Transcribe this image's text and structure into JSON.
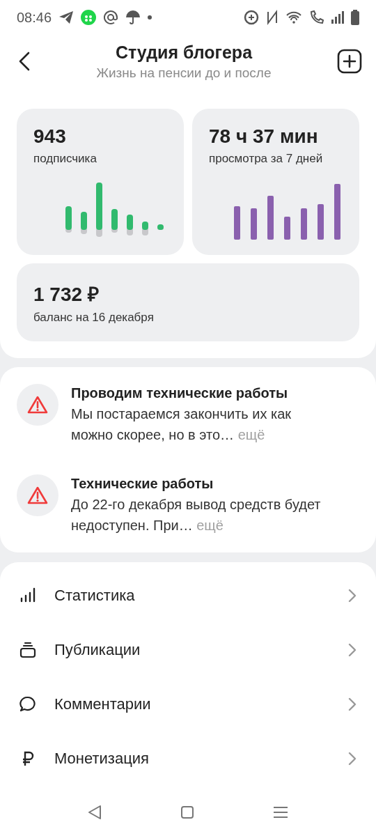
{
  "status_bar": {
    "time": "08:46"
  },
  "header": {
    "title": "Студия блогера",
    "subtitle": "Жизнь на пенсии до и после"
  },
  "stats": [
    {
      "value": "943",
      "label": "подписчика",
      "kind": "subscribers"
    },
    {
      "value": "78 ч 37 мин",
      "label": "просмотра за 7 дней",
      "kind": "views"
    },
    {
      "value": "1 732 ₽",
      "label": "баланс на 16 декабря",
      "kind": "balance"
    }
  ],
  "notices": [
    {
      "title": "Проводим технические работы",
      "text": "Мы постараемся закончить их как можно скорее, но в это…",
      "more": "ещё"
    },
    {
      "title": "Технические работы",
      "text": "До 22-го декабря вывод средств будет недоступен. При…",
      "more": "ещё"
    }
  ],
  "menu": [
    {
      "label": "Статистика",
      "kind": "stats"
    },
    {
      "label": "Публикации",
      "kind": "publications"
    },
    {
      "label": "Комментарии",
      "kind": "comments"
    },
    {
      "label": "Монетизация",
      "kind": "money"
    }
  ]
}
